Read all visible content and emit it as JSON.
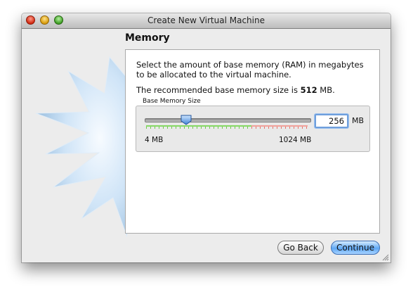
{
  "window": {
    "title": "Create New Virtual Machine"
  },
  "page": {
    "heading": "Memory",
    "description": "Select the amount of base memory (RAM) in megabytes to be allocated to the virtual machine.",
    "recommended_prefix": "The recommended base memory size is ",
    "recommended_value": "512",
    "recommended_suffix": " MB."
  },
  "memory_group": {
    "label": "Base Memory Size",
    "slider_min_label": "4 MB",
    "slider_max_label": "1024 MB",
    "value": "256",
    "unit": "MB",
    "slider_fraction": 0.25
  },
  "buttons": {
    "back": "Go Back",
    "continue": "Continue"
  },
  "colors": {
    "accent": "#5fa8f5",
    "safe_zone": "#6ccc4a",
    "over_zone": "#e6736b"
  }
}
